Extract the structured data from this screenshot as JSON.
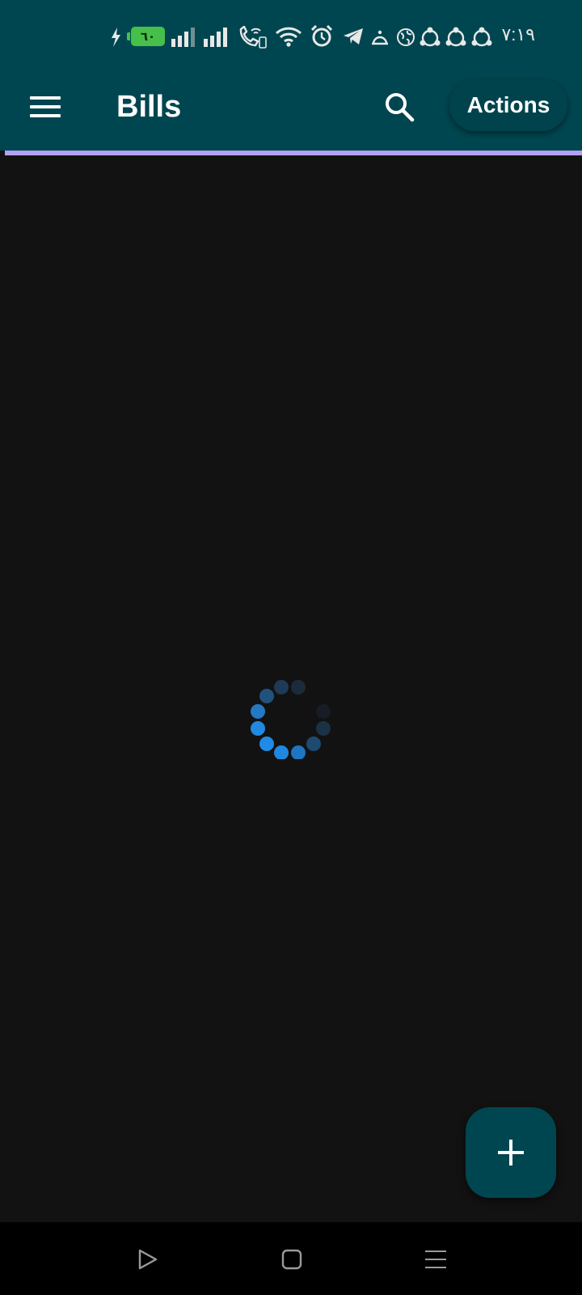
{
  "status_bar": {
    "battery_level": "٦٠",
    "time": "٧:١٩",
    "icons": [
      "charging-icon",
      "battery-icon",
      "signal-icon",
      "signal-icon",
      "wifi-calling-icon",
      "wifi-icon",
      "alarm-icon",
      "telegram-icon",
      "notification-icon",
      "globe-icon",
      "share-icon",
      "share-icon",
      "share-icon"
    ]
  },
  "app_bar": {
    "title": "Bills",
    "menu_icon": "menu-icon",
    "search_icon": "search-icon",
    "actions_label": "Actions",
    "background": "#004650",
    "accent_line_color": "#b3a1f5"
  },
  "content": {
    "state": "loading",
    "spinner_color": "#2196f3"
  },
  "fab": {
    "icon": "plus-icon",
    "background": "#004650"
  },
  "nav_bar": {
    "buttons": [
      "back-triangle-icon",
      "home-square-icon",
      "recents-menu-icon"
    ]
  }
}
